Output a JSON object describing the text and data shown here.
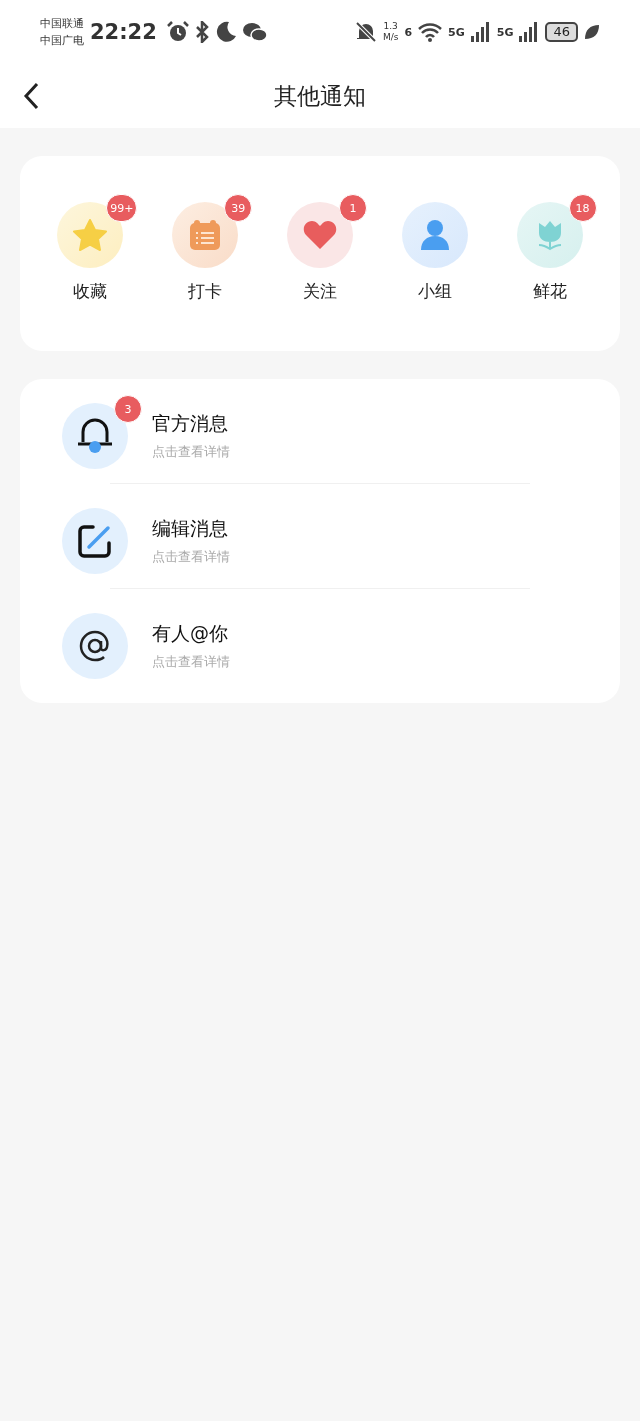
{
  "status_bar": {
    "carriers": [
      "中国联通",
      "中国广电"
    ],
    "time": "22:22",
    "speed": [
      "1.3",
      "M/s"
    ],
    "wifi_label": "6",
    "networks": [
      "5G",
      "5G"
    ],
    "battery": "46"
  },
  "nav": {
    "title": "其他通知"
  },
  "categories": [
    {
      "label": "收藏",
      "badge": "99+",
      "kind": "star"
    },
    {
      "label": "打卡",
      "badge": "39",
      "kind": "calendar"
    },
    {
      "label": "关注",
      "badge": "1",
      "kind": "heart"
    },
    {
      "label": "小组",
      "kind": "person"
    },
    {
      "label": "鲜花",
      "badge": "18",
      "kind": "flower"
    }
  ],
  "messages": [
    {
      "title": "官方消息",
      "subtitle": "点击查看详情",
      "badge": "3",
      "kind": "bell"
    },
    {
      "title": "编辑消息",
      "subtitle": "点击查看详情",
      "kind": "edit"
    },
    {
      "title": "有人@你",
      "subtitle": "点击查看详情",
      "kind": "at"
    }
  ]
}
